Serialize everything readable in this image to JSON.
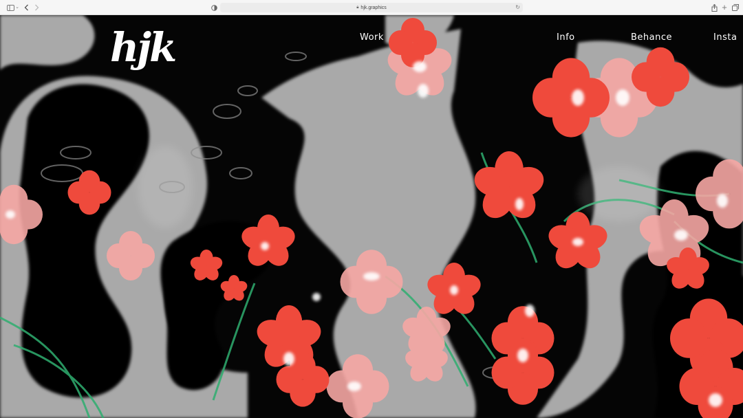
{
  "browser": {
    "url": "hjk.graphics",
    "icons": {
      "sidebar": "sidebar-icon",
      "back": "back-arrow-icon",
      "forward": "forward-arrow-icon",
      "shield": "shield-icon",
      "lock": "lock-icon",
      "reload": "reload-icon",
      "share": "share-icon",
      "new_tab": "plus-icon",
      "tabs": "tab-overview-icon"
    }
  },
  "site": {
    "logo": "hjk",
    "nav": {
      "work": "Work",
      "info": "Info",
      "behance": "Behance",
      "insta": "Insta"
    }
  },
  "colors": {
    "flower_red": "#ef4a3c",
    "flower_pink": "#f7a8a4",
    "stem_green": "#2fae70",
    "gray": "#a9a9a9",
    "black": "#050505"
  }
}
